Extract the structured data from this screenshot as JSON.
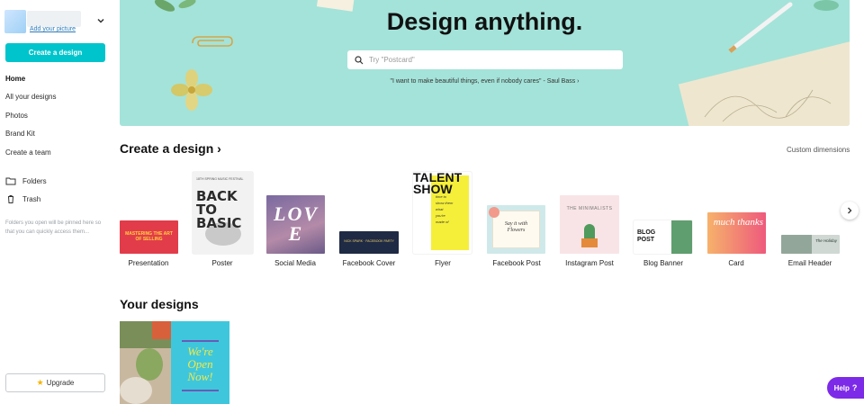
{
  "sidebar": {
    "add_picture": "Add your picture",
    "create_button": "Create a design",
    "nav": [
      {
        "label": "Home",
        "active": true
      },
      {
        "label": "All your designs"
      },
      {
        "label": "Photos"
      },
      {
        "label": "Brand Kit"
      },
      {
        "label": "Create a team"
      }
    ],
    "folders_label": "Folders",
    "trash_label": "Trash",
    "folders_hint": "Folders you open will be pinned here so that you can quickly access them...",
    "upgrade_label": "Upgrade"
  },
  "hero": {
    "title": "Design anything.",
    "search_placeholder": "Try \"Postcard\"",
    "quote": "\"I want to make beautiful things, even if nobody cares\" - Saul Bass ›"
  },
  "create_section": {
    "title": "Create a design ›",
    "custom_dimensions": "Custom dimensions",
    "templates": [
      {
        "label": "Presentation",
        "thumb_text": "MASTERING THE ART OF SELLING"
      },
      {
        "label": "Poster",
        "thumb_text": "BACK TO BASIC",
        "thumb_sub": "18TH SPRING MUSIC FESTIVAL"
      },
      {
        "label": "Social Media",
        "thumb_text": "LOVE"
      },
      {
        "label": "Facebook Cover",
        "thumb_text": "NICK SPARK · FACEBOOK PARTY"
      },
      {
        "label": "Flyer",
        "thumb_text": "TALENT SHOW",
        "thumb_sub": "time to show them what you're made of"
      },
      {
        "label": "Facebook Post",
        "thumb_text": "Say it with Flowers"
      },
      {
        "label": "Instagram Post",
        "thumb_text": "THE MINIMALISTS"
      },
      {
        "label": "Blog Banner",
        "thumb_text": "BLOG POST"
      },
      {
        "label": "Card",
        "thumb_text": "much thanks"
      },
      {
        "label": "Email Header",
        "thumb_text": "The Holiday"
      }
    ]
  },
  "your_designs": {
    "title": "Your designs",
    "cards": [
      {
        "thumb_text": ""
      },
      {
        "thumb_text": "We're Open Now!"
      }
    ]
  },
  "help_label": "Help",
  "colors": {
    "accent": "#00c4cc",
    "hero_bg": "#a4e3d9",
    "help": "#7d2ae8"
  }
}
